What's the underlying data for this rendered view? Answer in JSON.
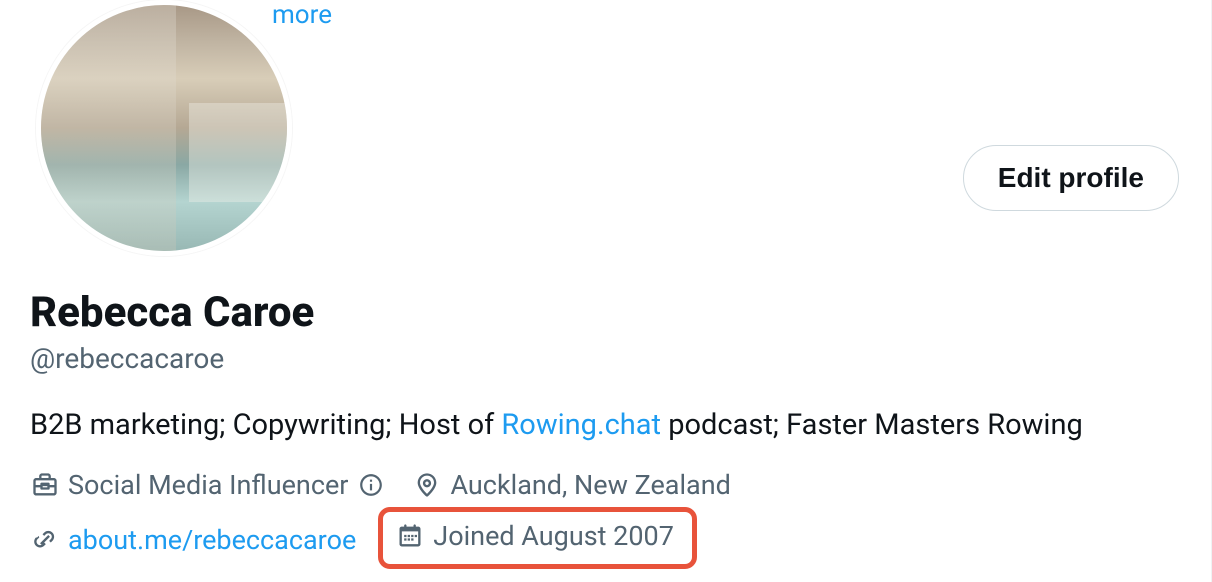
{
  "more_label": "more",
  "edit_profile_label": "Edit profile",
  "profile": {
    "display_name": "Rebecca Caroe",
    "username": "@rebeccacaroe",
    "bio_prefix": "B2B marketing; Copywriting; Host of ",
    "bio_link": "Rowing.chat",
    "bio_suffix": " podcast; Faster Masters Rowing"
  },
  "meta": {
    "category": "Social Media Influencer",
    "location": "Auckland, New Zealand",
    "website": "about.me/rebeccacaroe",
    "joined": "Joined August 2007"
  }
}
